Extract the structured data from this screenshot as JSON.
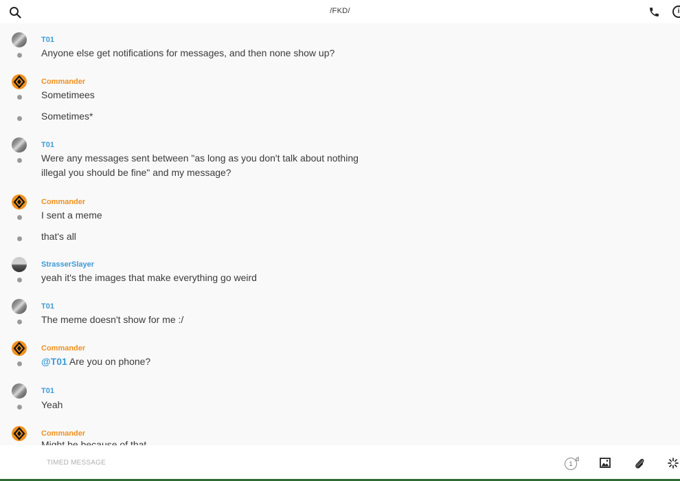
{
  "header": {
    "title": "/FKD/",
    "search_icon": "search-icon",
    "call_icon": "phone-icon",
    "info_icon": "info-icon",
    "info_glyph": "i"
  },
  "messages": [
    {
      "user": "T01",
      "color": "#3d9bd6",
      "avatar": "gray",
      "lines": [
        "Anyone else get notifications for messages, and then none show up?"
      ]
    },
    {
      "user": "Commander",
      "color": "#f0901e",
      "avatar": "commander",
      "lines": [
        "Sometimees",
        "Sometimes*"
      ]
    },
    {
      "user": "T01",
      "color": "#3d9bd6",
      "avatar": "gray",
      "lines": [
        "Were any messages sent between \"as long as you don't talk about nothing illegal you should be fine\" and my message?"
      ]
    },
    {
      "user": "Commander",
      "color": "#f0901e",
      "avatar": "commander",
      "lines": [
        "I sent a meme",
        "that's all"
      ]
    },
    {
      "user": "StrasserSlayer",
      "color": "#3d9bd6",
      "avatar": "strasser",
      "lines": [
        "yeah it's the images that make everything go weird"
      ]
    },
    {
      "user": "T01",
      "color": "#3d9bd6",
      "avatar": "gray",
      "lines": [
        "The meme doesn't show for me :/"
      ]
    },
    {
      "user": "Commander",
      "color": "#f0901e",
      "avatar": "commander",
      "mention": "@T01",
      "lines": [
        " Are you on phone?"
      ]
    },
    {
      "user": "T01",
      "color": "#3d9bd6",
      "avatar": "gray",
      "lines": [
        "Yeah"
      ]
    },
    {
      "user": "Commander",
      "color": "#f0901e",
      "avatar": "commander",
      "lines": [
        "Might be because of that"
      ]
    }
  ],
  "composer": {
    "placeholder": "TIMED MESSAGE",
    "timer_value": "1",
    "timer_unit": "d",
    "image_icon": "image-icon",
    "attach_icon": "paperclip-icon",
    "spark_icon": "sparkle-icon"
  }
}
